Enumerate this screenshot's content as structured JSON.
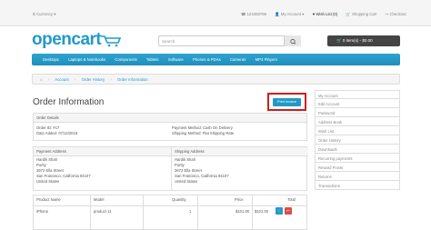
{
  "topbar": {
    "currency": "$ Currency ▾",
    "phone": "123456789",
    "account": "My Account ▾",
    "wishlist": "Wish List (0)",
    "cart": "Shopping Cart",
    "checkout": "Checkout"
  },
  "header": {
    "logo": "opencart",
    "search_placeholder": "Search",
    "cart_button": "0 item(s) - $0.00"
  },
  "menu": [
    "Desktops",
    "Laptops & Notebooks",
    "Components",
    "Tablets",
    "Software",
    "Phones & PDAs",
    "Cameras",
    "MP3 Players"
  ],
  "breadcrumb": [
    "Account",
    "Order History",
    "Order Information"
  ],
  "page_title": "Order Information",
  "print_button": "Print Invoice",
  "order_details": {
    "heading": "Order Details",
    "order_id": "Order ID: #17",
    "date_added": "Date Added: 07/12/2018",
    "payment_method": "Payment Method: Cash On Delivery",
    "shipping_method": "Shipping Method: Flat Shipping Rate"
  },
  "addresses": {
    "payment_heading": "Payment Address",
    "shipping_heading": "Shipping Address",
    "payment_lines": [
      "Hardik Shah",
      "Purity",
      "3672 Ella Street",
      "San Francisco, California 94107",
      "United States"
    ],
    "shipping_lines": [
      "Hardik Shah",
      "Purity",
      "3672 Ella Street",
      "San Francisco, California 94107",
      "United States"
    ]
  },
  "products": {
    "headers": [
      "Product Name",
      "Model",
      "Quantity",
      "Price",
      "Total"
    ],
    "row": [
      "iPhone",
      "product 11",
      "1",
      "$101.00",
      "$101.00"
    ]
  },
  "sidebar": [
    "My Account",
    "Edit Account",
    "Password",
    "Address Book",
    "Wish List",
    "Order History",
    "Downloads",
    "Recurring payments",
    "Reward Points",
    "Returns",
    "Transactions"
  ],
  "colors": {
    "accent": "#229ac8",
    "highlight": "#cc1f1f",
    "dark": "#444444"
  }
}
